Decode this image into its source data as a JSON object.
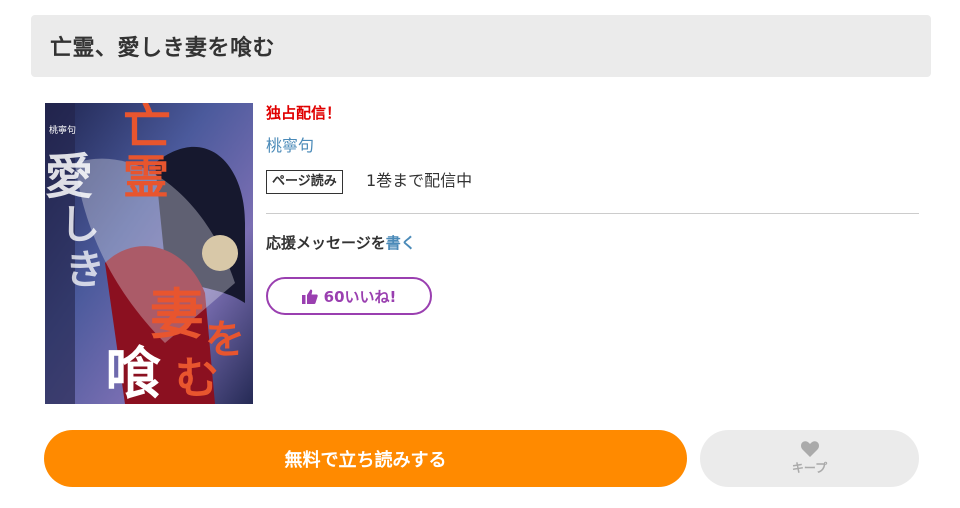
{
  "header": {
    "title": "亡霊、愛しき妻を喰む"
  },
  "cover": {
    "alt": "亡霊、愛しき妻を喰む",
    "author_small": "桃寧句",
    "title_chars": [
      "亡",
      "霊",
      "愛",
      "し",
      "き",
      "妻",
      "を",
      "喰",
      "む"
    ]
  },
  "info": {
    "exclusive": "独占配信！",
    "author": "桃寧句",
    "format_badge": "ページ読み",
    "availability": "1巻まで配信中",
    "support_text": "応援メッセージを",
    "support_link": "書く",
    "like_label": "60いいね!",
    "like_count": 60
  },
  "actions": {
    "read_label": "無料で立ち読みする",
    "keep_label": "キープ"
  },
  "colors": {
    "accent_orange": "#ff8a00",
    "like_purple": "#9a3fb0",
    "link_blue": "#4a8ab8",
    "exclusive_red": "#e00000"
  },
  "icons": {
    "like": "thumbs-up-icon",
    "keep": "heart-icon"
  }
}
